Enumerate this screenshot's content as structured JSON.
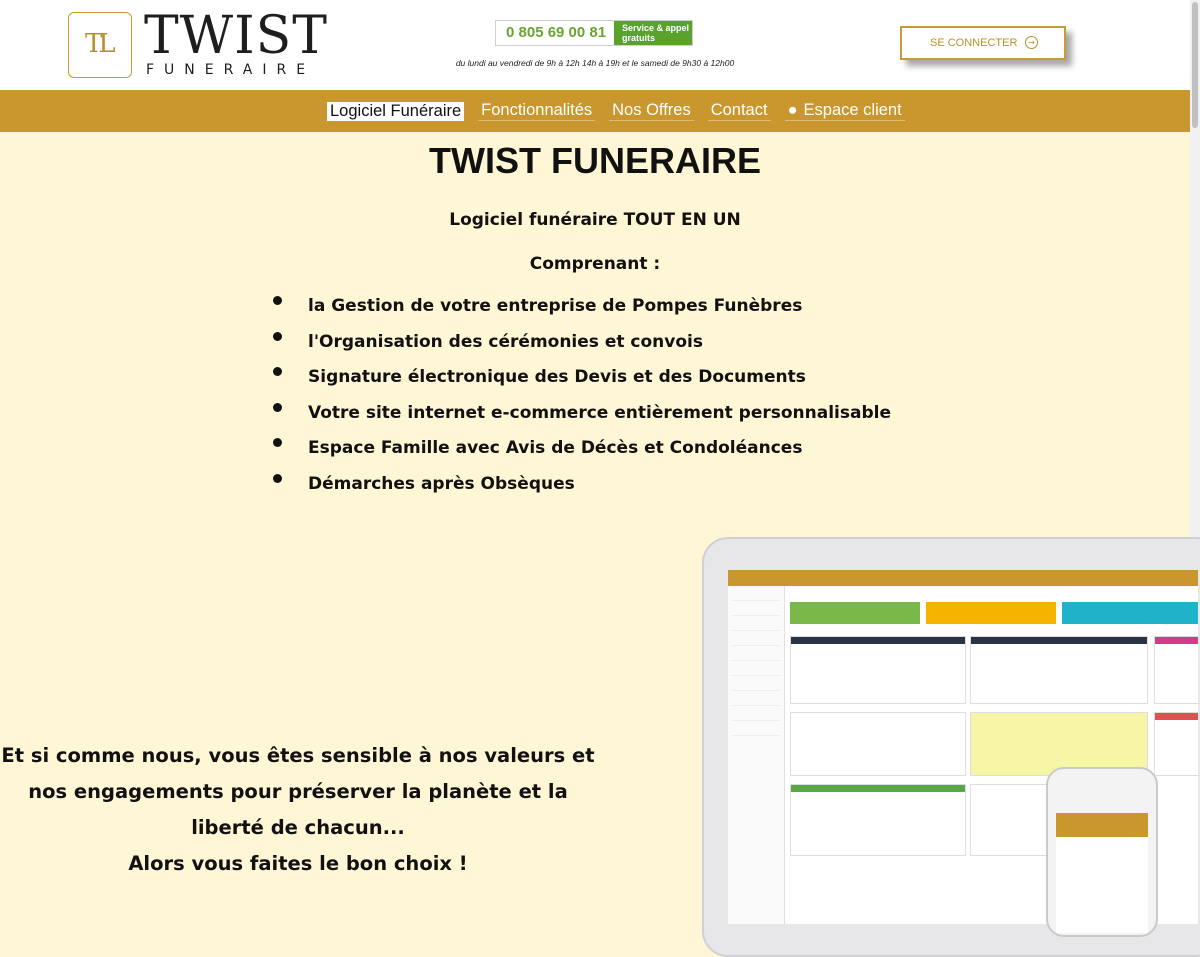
{
  "brand": {
    "monogram": "TL",
    "name": "TWIST",
    "sub": "FUNERAIRE"
  },
  "contact": {
    "phone": "0 805 69 00 81",
    "badge": "Service & appel gratuits",
    "hours": "du lundi au vendredi de 9h à 12h 14h à 19h et le samedi de 9h30 à 12h00"
  },
  "header": {
    "connect_label": "SE CONNECTER"
  },
  "nav": {
    "items": [
      {
        "label": "Logiciel Funéraire",
        "active": true
      },
      {
        "label": "Fonctionnalités"
      },
      {
        "label": "Nos Offres"
      },
      {
        "label": "Contact"
      },
      {
        "label": "Espace client"
      }
    ]
  },
  "main": {
    "title": "TWIST FUNERAIRE",
    "tagline": "Logiciel funéraire TOUT EN UN",
    "comprenant": "Comprenant :",
    "features": [
      "la Gestion de votre entreprise de Pompes Funèbres",
      "l'Organisation des cérémonies et convois",
      "Signature électronique des Devis et des Documents",
      "Votre site internet e-commerce entièrement personnalisable",
      "Espace Famille avec Avis de Décès et Condoléances",
      "Démarches après Obsèques"
    ],
    "valeurs": "Et si comme nous, vous êtes sensible à nos valeurs et nos engagements pour préserver la planète et la liberté de chacun...",
    "choix": "Alors vous faites le bon choix !"
  },
  "colors": {
    "gold": "#c9972d",
    "cream": "#fff6d6",
    "phone_green": "#6aa532"
  }
}
